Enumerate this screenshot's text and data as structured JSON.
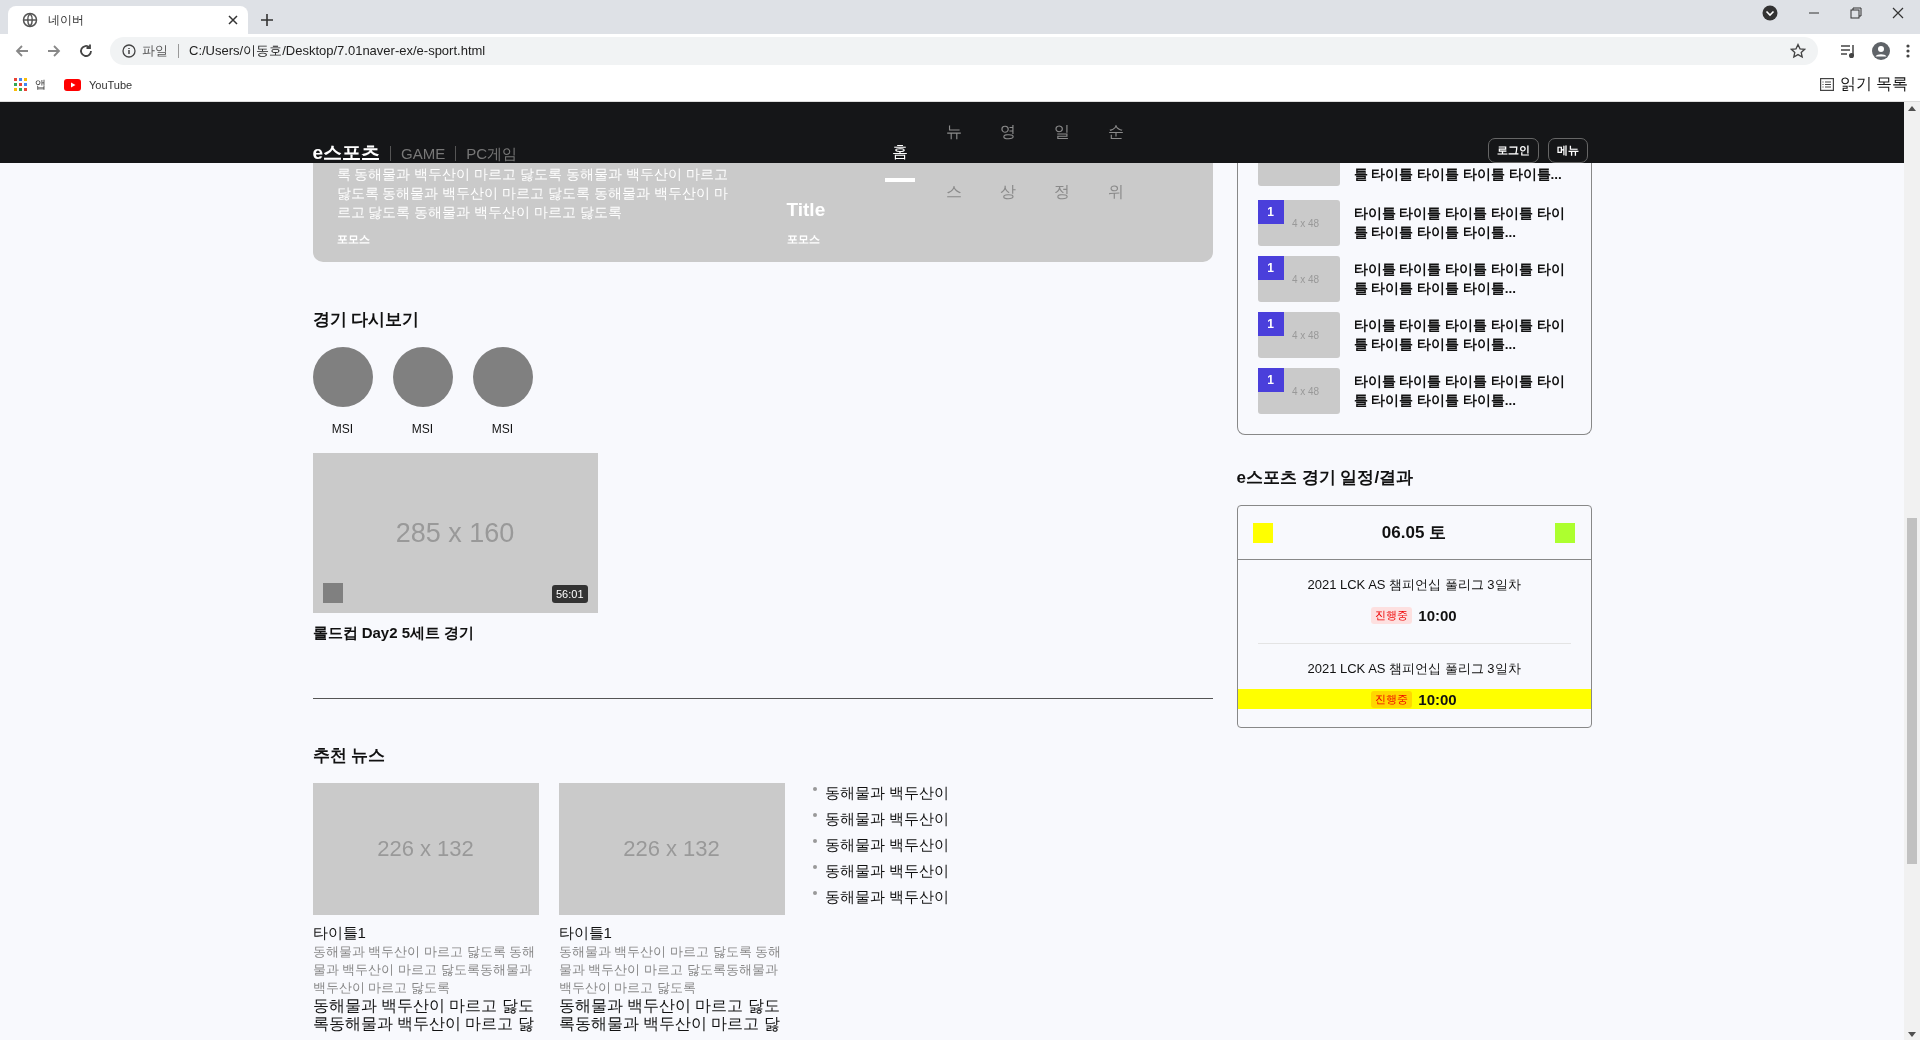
{
  "browser": {
    "tab": {
      "title": "네이버"
    },
    "address": {
      "scheme": "파일",
      "url": "C:/Users/이동호/Desktop/7.01naver-ex/e-sport.html"
    },
    "bookmarks": [
      {
        "label": "앱",
        "kind": "apps"
      },
      {
        "label": "YouTube",
        "kind": "youtube"
      }
    ],
    "reading_list": "읽기 목록"
  },
  "header": {
    "logo": "e스포츠",
    "links": [
      "GAME",
      "PC게임"
    ],
    "nav": [
      {
        "label": "홈",
        "selected": true
      },
      {
        "label": "뉴스",
        "selected": false
      },
      {
        "label": "영상",
        "selected": false
      },
      {
        "label": "일정",
        "selected": false
      },
      {
        "label": "순위",
        "selected": false
      }
    ],
    "buttons": [
      "로그인",
      "메뉴"
    ]
  },
  "banner": {
    "items": [
      {
        "text": "록 동해물과 백두산이 마르고 닳도록 동해물과 백두산이 마르고 닳도록 동해물과 백두산이 마르고 닳도록 동해물과 백두산이 마르고 닳도록 동해물과 백두산이 마르고 닳도록",
        "source": "포모스"
      },
      {
        "title": "Title",
        "source": "포모스"
      }
    ]
  },
  "replay": {
    "title": "경기 다시보기",
    "channels": [
      {
        "label": "MSI"
      },
      {
        "label": "MSI"
      },
      {
        "label": "MSI"
      }
    ],
    "video": {
      "image_label": "285 x 160",
      "duration": "56:01",
      "caption": "롤드컵 Day2 5세트 경기"
    }
  },
  "news": {
    "title": "추천 뉴스",
    "cards": [
      {
        "image_label": "226 x 132",
        "title": "타이틀1",
        "summary": "동해물과 백두산이 마르고 닳도록 동해물과 백두산이 마르고 닳도록동해물과 백두산이 마르고 닳도록",
        "body": "동해물과 백두산이 마르고 닳도록동해물과 백두산이 마르고 닳"
      },
      {
        "image_label": "226 x 132",
        "title": "타이틀1",
        "summary": "동해물과 백두산이 마르고 닳도록 동해물과 백두산이 마르고 닳도록동해물과 백두산이 마르고 닳도록",
        "body": "동해물과 백두산이 마르고 닳도록동해물과 백두산이 마르고 닳"
      }
    ],
    "links": [
      "동해물과 백두산이",
      "동해물과 백두산이",
      "동해물과 백두산이",
      "동해물과 백두산이",
      "동해물과 백두산이"
    ]
  },
  "ranking": {
    "items": [
      {
        "title": "틀 타이틀 타이틀 타이틀 타이틀..."
      },
      {
        "rank": "1",
        "image_label": "4 x 48",
        "title": "타이틀 타이틀 타이틀 타이틀 타이틀 타이틀 타이틀 타이틀..."
      },
      {
        "rank": "1",
        "image_label": "4 x 48",
        "title": "타이틀 타이틀 타이틀 타이틀 타이틀 타이틀 타이틀 타이틀..."
      },
      {
        "rank": "1",
        "image_label": "4 x 48",
        "title": "타이틀 타이틀 타이틀 타이틀 타이틀 타이틀 타이틀 타이틀..."
      },
      {
        "rank": "1",
        "image_label": "4 x 48",
        "title": "타이틀 타이틀 타이틀 타이틀 타이틀 타이틀 타이틀 타이틀..."
      }
    ]
  },
  "schedule": {
    "title": "e스포츠 경기 일정/결과",
    "date": "06.05 토",
    "nav_squares": [
      {
        "color": "#ffff00"
      },
      {
        "color": "#adff2f"
      }
    ],
    "matches": [
      {
        "name": "2021 LCK AS 챔피언십 풀리그 3일차",
        "status": "진행중",
        "time": "10:00",
        "highlighted": false
      },
      {
        "name": "2021 LCK AS 챔피언십 풀리그 3일차",
        "status": "진행중",
        "time": "10:00",
        "highlighted": true
      }
    ]
  }
}
